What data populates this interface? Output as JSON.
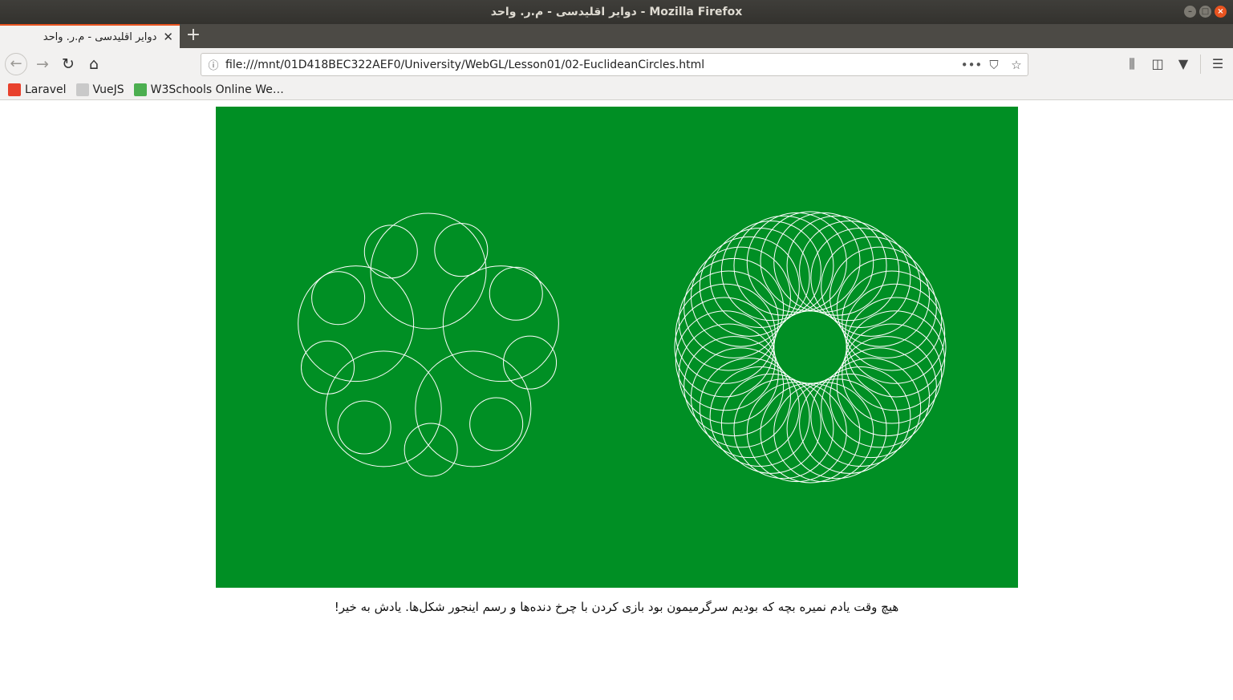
{
  "window": {
    "title": "دوایر اقلیدسی - م.ر. واحد - Mozilla Firefox"
  },
  "tab": {
    "label": "دوایر اقلیدسی - م.ر. واحد"
  },
  "urlbar": {
    "url": "file:///mnt/01D418BEC322AEF0/University/WebGL/Lesson01/02-EuclideanCircles.html"
  },
  "bookmarks": [
    {
      "label": "Laravel",
      "color": "#e8412c"
    },
    {
      "label": "VueJS",
      "color": "#c9c9c9"
    },
    {
      "label": "W3Schools Online We…",
      "color": "#4caf50"
    }
  ],
  "canvas": {
    "background": "#008f24",
    "stroke": "#ffffff"
  },
  "caption": "هیچ وقت یادم نمیره بچه که بودیم سرگرمیمون بود بازی کردن با چرخ دنده‌ها و رسم اینجور شکل‌ها. یادش به خیر!"
}
